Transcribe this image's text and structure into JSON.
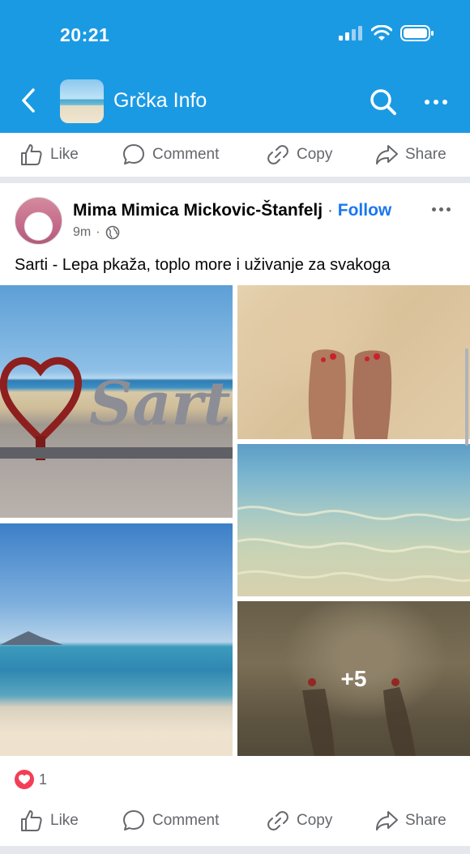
{
  "status": {
    "time": "20:21"
  },
  "nav": {
    "title": "Grčka Info"
  },
  "actions": {
    "like": "Like",
    "comment": "Comment",
    "copy": "Copy",
    "share": "Share"
  },
  "post": {
    "author": "Mima Mimica Mickovic-Štanfelj",
    "separator": "·",
    "follow": "Follow",
    "time": "9m",
    "meta_separator": "·",
    "caption": "Sarti - Lepa pkaža, toplo more i uživanje za svakoga",
    "more_photos": "+5",
    "reaction_count": "1"
  },
  "colors": {
    "header_blue": "#1b9ae4",
    "follow_blue": "#1877f2",
    "love_red": "#f33e58"
  }
}
